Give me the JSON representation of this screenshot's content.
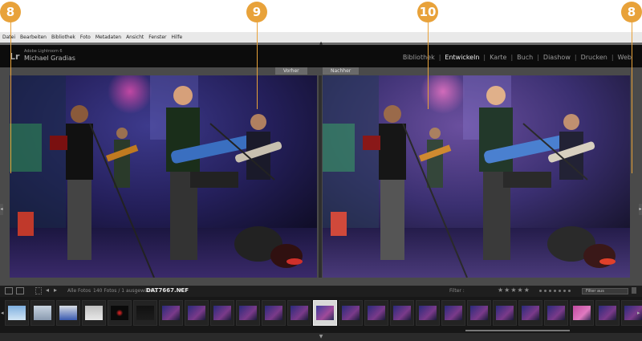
{
  "callouts": [
    "8",
    "9",
    "10",
    "8"
  ],
  "menu": [
    "Datei",
    "Bearbeiten",
    "Bibliothek",
    "Foto",
    "Metadaten",
    "Ansicht",
    "Fenster",
    "Hilfe"
  ],
  "identity": {
    "logo": "Lr",
    "product": "Adobe Lightroom 6",
    "user": "Michael Gradias"
  },
  "modules": [
    {
      "label": "Bibliothek",
      "active": false
    },
    {
      "label": "Entwickeln",
      "active": true
    },
    {
      "label": "Karte",
      "active": false
    },
    {
      "label": "Buch",
      "active": false
    },
    {
      "label": "Diashow",
      "active": false
    },
    {
      "label": "Drucken",
      "active": false
    },
    {
      "label": "Web",
      "active": false
    }
  ],
  "compare": {
    "before_label": "Vorher",
    "after_label": "Nachher"
  },
  "toolbar": {
    "source": "Alle Fotos",
    "count": "140 Fotos / 1 ausgewählt /",
    "filename": "DAT7667.NEF",
    "filter_label": "Filter :",
    "stars": "★★★★★",
    "filter_select": "Filter aus"
  },
  "filmstrip": {
    "thumbnails": [
      {
        "kind": "blue-sky"
      },
      {
        "kind": "harbor"
      },
      {
        "kind": "car-blue"
      },
      {
        "kind": "car-white"
      },
      {
        "kind": "dark-red"
      },
      {
        "kind": "dark"
      },
      {
        "kind": "stage"
      },
      {
        "kind": "stage"
      },
      {
        "kind": "stage"
      },
      {
        "kind": "stage"
      },
      {
        "kind": "stage"
      },
      {
        "kind": "stage"
      },
      {
        "kind": "stage-selected"
      },
      {
        "kind": "stage"
      },
      {
        "kind": "stage"
      },
      {
        "kind": "stage"
      },
      {
        "kind": "stage"
      },
      {
        "kind": "stage"
      },
      {
        "kind": "stage"
      },
      {
        "kind": "stage"
      },
      {
        "kind": "stage"
      },
      {
        "kind": "stage"
      },
      {
        "kind": "stage-pink"
      },
      {
        "kind": "stage"
      },
      {
        "kind": "stage"
      }
    ],
    "selected_index": 12
  },
  "colors": {
    "callout": "#e8a23a",
    "active_module": "#f0f0f0",
    "stage_blue": "#3b3b9a",
    "stage_magenta": "#b03a8a"
  }
}
